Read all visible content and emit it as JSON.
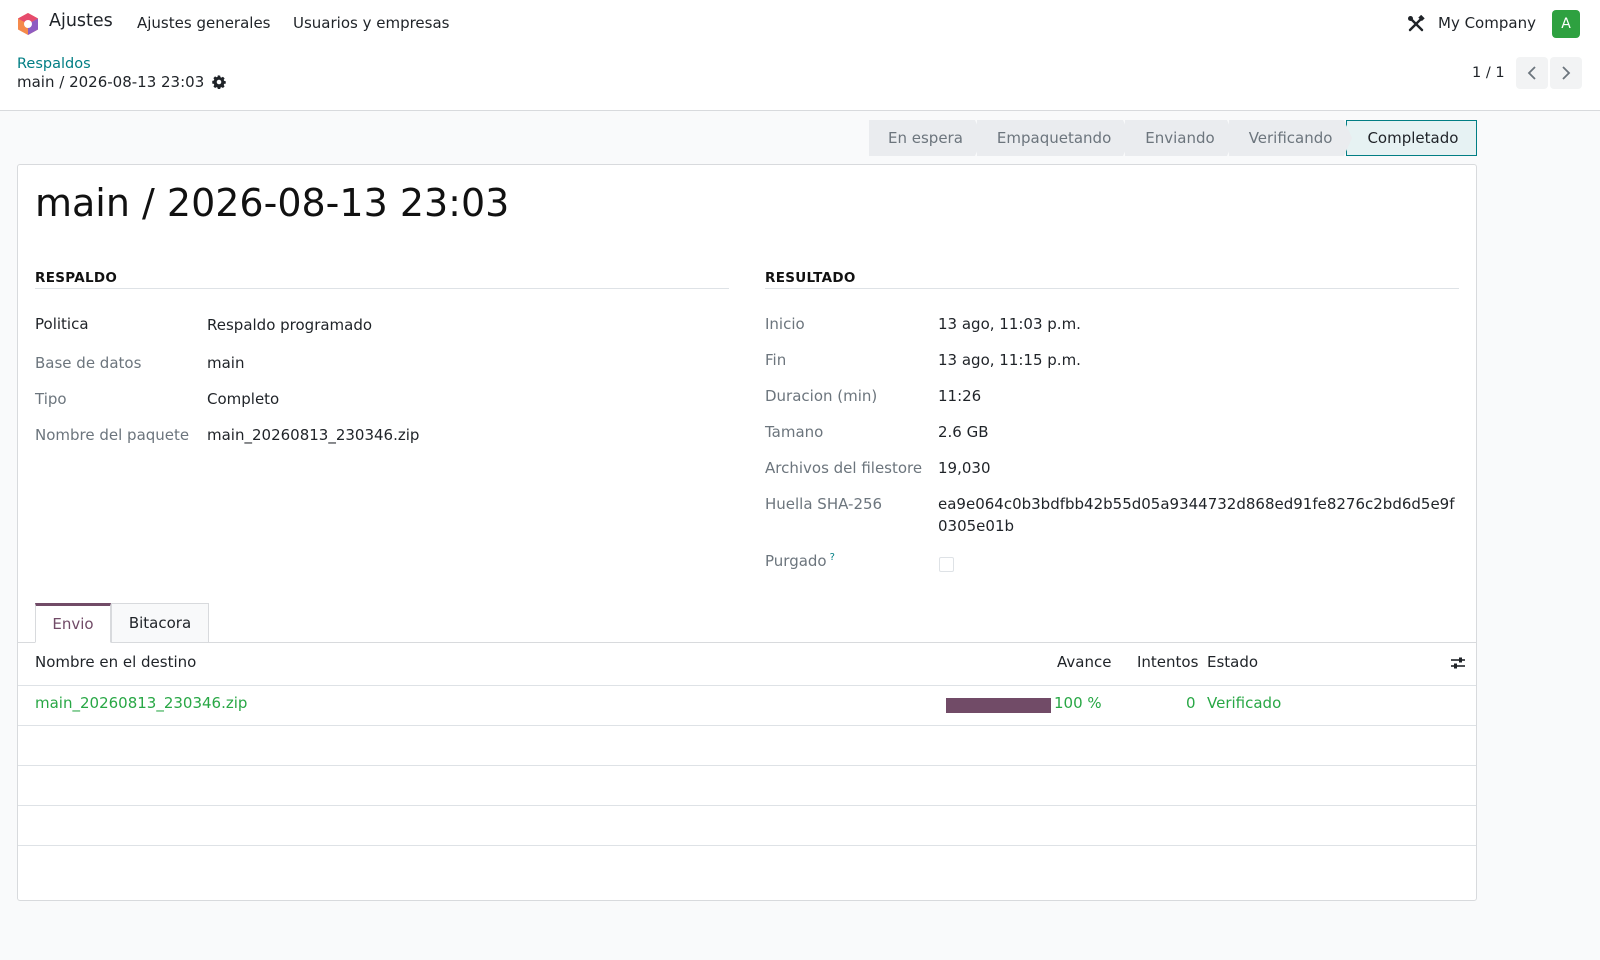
{
  "navbar": {
    "app_name": "Ajustes",
    "menu": [
      "Ajustes generales",
      "Usuarios y empresas"
    ],
    "company": "My Company",
    "avatar_letter": "A"
  },
  "breadcrumb": {
    "parent": "Respaldos",
    "current": "main / 2026-08-13 23:03"
  },
  "pager": {
    "value": "1 / 1"
  },
  "statusbar": {
    "stages": [
      "En espera",
      "Empaquetando",
      "Enviando",
      "Verificando",
      "Completado"
    ],
    "active": "Completado"
  },
  "record": {
    "title": "main / 2026-08-13 23:03",
    "respaldo": {
      "heading": "RESPALDO",
      "fields": [
        {
          "label": "Politica",
          "value": "Respaldo programado"
        },
        {
          "label": "Base de datos",
          "value": "main"
        },
        {
          "label": "Tipo",
          "value": "Completo"
        },
        {
          "label": "Nombre del paquete",
          "value": "main_20260813_230346.zip"
        }
      ]
    },
    "resultado": {
      "heading": "RESULTADO",
      "fields": [
        {
          "label": "Inicio",
          "value": "13 ago, 11:03 p.m."
        },
        {
          "label": "Fin",
          "value": "13 ago, 11:15 p.m."
        },
        {
          "label": "Duracion (min)",
          "value": "11:26"
        },
        {
          "label": "Tamano",
          "value": "2.6 GB"
        },
        {
          "label": "Archivos del filestore",
          "value": "19,030"
        },
        {
          "label": "Huella SHA-256",
          "value": "ea9e064c0b3bdfbb42b55d05a9344732d868ed91fe8276c2bd6d5e9f0305e01b"
        }
      ],
      "purgado": {
        "label": "Purgado",
        "help": "?",
        "checked": false
      }
    }
  },
  "tabs": [
    "Envio",
    "Bitacora"
  ],
  "table": {
    "columns": [
      "Nombre en el destino",
      "Avance",
      "Intentos",
      "Estado"
    ],
    "rows": [
      {
        "name": "main_20260813_230346.zip",
        "progress": 100,
        "progress_label": "100 %",
        "attempts": "0",
        "state": "Verificado"
      }
    ]
  },
  "colors": {
    "brand": "#714b67",
    "link": "#017e84",
    "success": "#28a745"
  }
}
